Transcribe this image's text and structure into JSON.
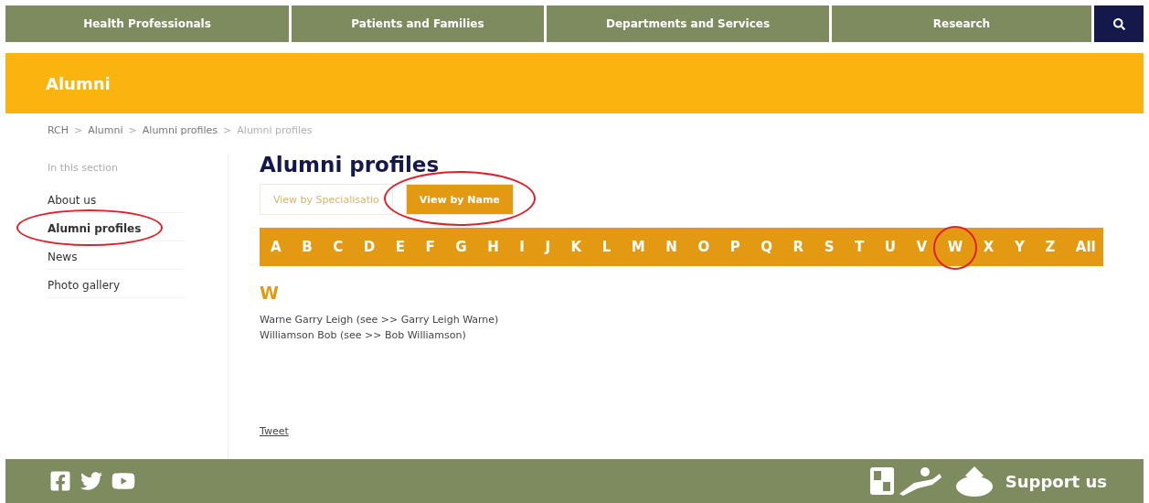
{
  "nav": {
    "items": [
      "Health Professionals",
      "Patients and Families",
      "Departments and Services",
      "Research"
    ]
  },
  "banner": {
    "title": "Alumni"
  },
  "breadcrumb": [
    {
      "label": "RCH",
      "current": false
    },
    {
      "label": "Alumni",
      "current": false
    },
    {
      "label": "Alumni profiles",
      "current": false
    },
    {
      "label": "Alumni profiles",
      "current": true
    }
  ],
  "breadcrumb_separator": ">",
  "sidebar": {
    "heading": "In this section",
    "items": [
      {
        "label": "About us",
        "selected": false,
        "circled": false
      },
      {
        "label": "Alumni profiles",
        "selected": true,
        "circled": true
      },
      {
        "label": "News",
        "selected": false,
        "circled": false
      },
      {
        "label": "Photo gallery",
        "selected": false,
        "circled": false
      }
    ]
  },
  "page_title": "Alumni profiles",
  "view_tabs": [
    {
      "label": "View by Specialisatio",
      "selected": false,
      "circled": false
    },
    {
      "label": "View by Name",
      "selected": true,
      "circled": true
    }
  ],
  "letters": [
    {
      "label": "A",
      "circled": false
    },
    {
      "label": "B",
      "circled": false
    },
    {
      "label": "C",
      "circled": false
    },
    {
      "label": "D",
      "circled": false
    },
    {
      "label": "E",
      "circled": false
    },
    {
      "label": "F",
      "circled": false
    },
    {
      "label": "G",
      "circled": false
    },
    {
      "label": "H",
      "circled": false
    },
    {
      "label": "I",
      "circled": false
    },
    {
      "label": "J",
      "circled": false
    },
    {
      "label": "K",
      "circled": false
    },
    {
      "label": "L",
      "circled": false
    },
    {
      "label": "M",
      "circled": false
    },
    {
      "label": "N",
      "circled": false
    },
    {
      "label": "O",
      "circled": false
    },
    {
      "label": "P",
      "circled": false
    },
    {
      "label": "Q",
      "circled": false
    },
    {
      "label": "R",
      "circled": false
    },
    {
      "label": "S",
      "circled": false
    },
    {
      "label": "T",
      "circled": false
    },
    {
      "label": "U",
      "circled": false
    },
    {
      "label": "V",
      "circled": false
    },
    {
      "label": "W",
      "circled": true
    },
    {
      "label": "X",
      "circled": false
    },
    {
      "label": "Y",
      "circled": false
    },
    {
      "label": "Z",
      "circled": false
    },
    {
      "label": "All",
      "circled": false
    }
  ],
  "section_letter": "W",
  "entries": [
    "Warne Garry Leigh (see >> Garry Leigh Warne)",
    "Williamson Bob (see >> Bob Williamson)"
  ],
  "tweet_link": "Tweet",
  "footer": {
    "support": "Support us"
  }
}
